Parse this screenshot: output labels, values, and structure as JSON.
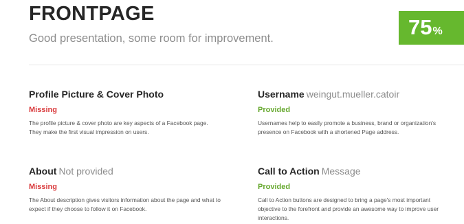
{
  "header": {
    "title": "FRONTPAGE",
    "subtitle": "Good presentation, some room for improvement.",
    "score": "75",
    "score_unit": "%"
  },
  "colors": {
    "score_bg": "#66b82e",
    "missing": "#d9383a",
    "provided": "#66a82e"
  },
  "items": [
    {
      "name": "Profile Picture & Cover Photo",
      "value": "",
      "status": "Missing",
      "description": "The profile picture & cover photo are key aspects of a Facebook page. They make the first visual impression on users."
    },
    {
      "name": "Username",
      "value": "weingut.mueller.catoir",
      "status": "Provided",
      "description": "Usernames help to easily promote a business, brand or organization's presence on Facebook with a shortened Page address."
    },
    {
      "name": "About",
      "value": "Not provided",
      "status": "Missing",
      "description": "The About description gives visitors information about the page and what to expect if they choose to follow it on Facebook."
    },
    {
      "name": "Call to Action",
      "value": "Message",
      "status": "Provided",
      "description": "Call to Action buttons are designed to bring a page's most important objective to the forefront and provide an awesome way to improve user interactions."
    }
  ]
}
